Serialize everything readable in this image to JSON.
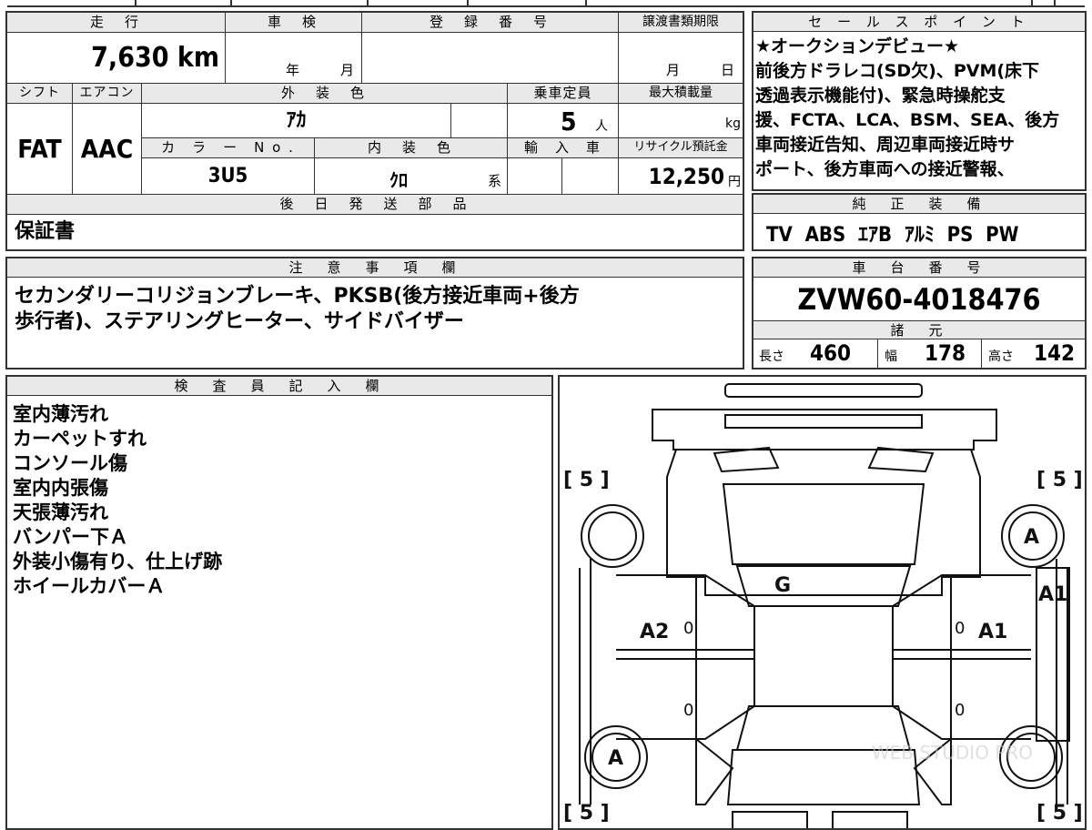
{
  "top_strip": {
    "visible": true
  },
  "vehicle": {
    "mileage_label": "走　行",
    "mileage": "7,630 km",
    "inspection_label": "車　検",
    "inspection_year": "年",
    "inspection_month": "月",
    "registration_label": "登　録　番　号",
    "transfer_label": "譲渡書類期限",
    "transfer_month": "月",
    "transfer_day": "日",
    "shift_label": "シフト",
    "aircon_label": "エアコン",
    "shift": "FAT",
    "aircon": "AAC",
    "exterior_color_label": "外　装　色",
    "exterior_color": "ｱｶ",
    "capacity_label": "乗車定員",
    "capacity": "5",
    "capacity_unit": "人",
    "max_load_label": "最大積載量",
    "max_load_unit": "kg",
    "color_no_label": "カ　ラ　ー　N o .",
    "color_no": "3U5",
    "interior_color_label": "内　装　色",
    "interior_color": "ｸﾛ",
    "interior_suffix": "系",
    "import_label": "輸　入　車",
    "recycle_label": "リサイクル預託金",
    "recycle_fee": "12,250",
    "recycle_unit": "円"
  },
  "parts": {
    "label": "後　日　発　送　部　品",
    "value": "保証書"
  },
  "sales_point": {
    "label": "セ ー ル ス ポ イ ン ト",
    "lines": [
      "★オークションデビュー★",
      "前後方ドラレコ(SD欠)、PVM(床下",
      "透過表示機能付)、緊急時操舵支",
      "援、FCTA、LCA、BSM、SEA、後方",
      "車両接近告知、周辺車両接近時サ",
      "ポート、後方車両への接近警報、"
    ]
  },
  "genuine_equipment": {
    "label": "純　正　装　備",
    "value": "TV  ABS  ｴｱB  ｱﾙﾐ  PS  PW"
  },
  "notes": {
    "label": "注　意　事　項　欄",
    "lines": [
      "セカンダリーコリジョンブレーキ、PKSB(後方接近車両+後方",
      "歩行者)、ステアリングヒーター、サイドバイザー"
    ]
  },
  "chassis": {
    "label": "車　台　番　号",
    "number": "ZVW60-4018476"
  },
  "specs": {
    "label": "諸　元",
    "length_label": "長さ",
    "length": "460",
    "width_label": "幅",
    "width": "178",
    "height_label": "高さ",
    "height": "142"
  },
  "inspector": {
    "label": "検　査　員　記　入　欄",
    "lines": [
      "室内薄汚れ",
      "カーペットすれ",
      "コンソール傷",
      "室内内張傷",
      "天張薄汚れ",
      "バンパー下Ａ",
      "外装小傷有り、仕上げ跡",
      "ホイールカバーＡ"
    ]
  },
  "diagram": {
    "tire_fl": "[ 5 ]",
    "tire_fr": "[ 5 ]",
    "tire_rl": "[ 5 ]",
    "tire_rr": "[ 5 ]",
    "windshield": "G",
    "wheel_fr": "A",
    "wheel_rl": "A",
    "door_fl": "A2",
    "door_fr": "A1",
    "fender_r": "A1",
    "zero_1": "0",
    "zero_2": "0",
    "zero_3": "0",
    "zero_4": "0",
    "watermark": "WEB STUDIO PRO"
  }
}
